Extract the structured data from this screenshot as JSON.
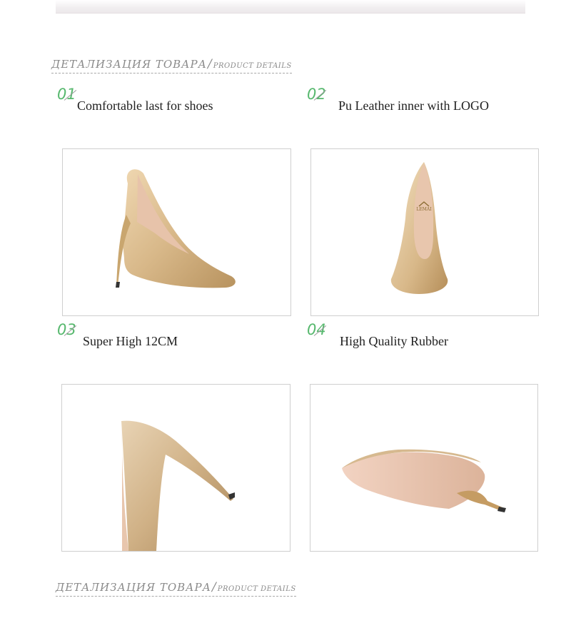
{
  "page": {
    "heading_top": {
      "ru": "ДЕТАЛИЗАЦИЯ ТОВАРА",
      "slash": "/",
      "en": "PRODUCT DETAILS"
    },
    "heading_bottom": {
      "ru": "ДЕТАЛИЗАЦИЯ ТОВАРА",
      "slash": "/",
      "en": "PRODUCT DETAILS"
    }
  },
  "details": [
    {
      "number": "01",
      "label": "Comfortable last for shoes",
      "image": "gold-pump-side-view"
    },
    {
      "number": "02",
      "label": "Pu Leather inner with LOGO",
      "image": "gold-pump-front-logo-view"
    },
    {
      "number": "03",
      "label": "Super High 12CM",
      "image": "gold-pump-heel-closeup"
    },
    {
      "number": "04",
      "label": "High Quality Rubber",
      "image": "gold-pump-sole-view"
    }
  ],
  "brand_logo_text": "LEMAI",
  "colors": {
    "number_accent": "#57b86e",
    "heading_gray": "#8a8a8a",
    "gold_shoe": "#d8b889",
    "nude_lining": "#e8c6ad"
  }
}
